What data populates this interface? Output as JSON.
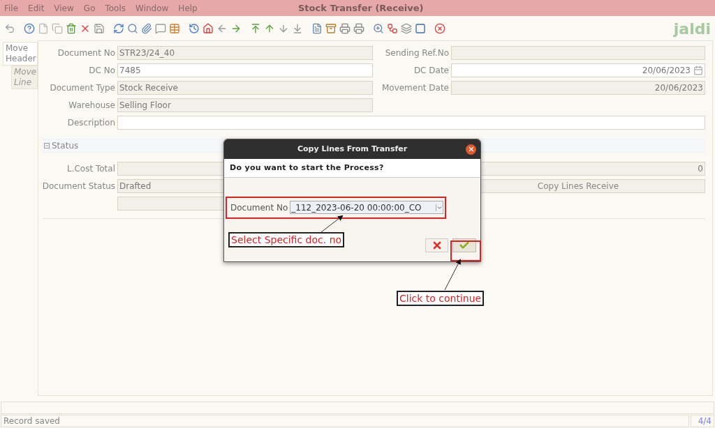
{
  "window": {
    "title": "Stock Transfer (Receive)"
  },
  "menu": [
    {
      "label": "File"
    },
    {
      "label": "Edit"
    },
    {
      "label": "View"
    },
    {
      "label": "Go"
    },
    {
      "label": "Tools"
    },
    {
      "label": "Window"
    },
    {
      "label": "Help"
    }
  ],
  "logo": "jaldi",
  "side_tabs": [
    {
      "label": "Move Header",
      "selected": true
    },
    {
      "label": "Move Line",
      "selected": false
    }
  ],
  "header_rows": [
    {
      "left": {
        "label": "Document No",
        "value": "STR23/24_40",
        "editable": false
      },
      "right": {
        "label": "Sending Ref.No",
        "editable": false
      }
    },
    {
      "left": {
        "label": "DC No",
        "value": "7485",
        "editable": true
      },
      "right": {
        "label": "DC Date",
        "value": "20/06/2023",
        "editable": true,
        "kind": "date"
      }
    },
    {
      "left": {
        "label": "Document Type",
        "value": "Stock Receive",
        "editable": false
      },
      "right": {
        "label": "Movement Date",
        "value": "20/06/2023",
        "editable": false
      }
    },
    {
      "left": {
        "label": "Warehouse",
        "value": "Selling Floor",
        "editable": false
      }
    }
  ],
  "description": {
    "label": "Description",
    "editable": true
  },
  "status_section": {
    "title": "Status",
    "expanded": true,
    "cost_total": {
      "label": "L.Cost Total",
      "value": "0"
    },
    "document_status": {
      "label": "Document Status",
      "value": "Drafted"
    },
    "copy_button": "Copy Lines Receive"
  },
  "dialog": {
    "title": "Copy Lines From Transfer",
    "question": "Do you want to start the Process?",
    "param_label": "Document No",
    "param_value": "_112_2023-06-20 00:00:00_CO"
  },
  "annotations": [
    {
      "kind": "select",
      "text": "Select Specific doc. no"
    },
    {
      "kind": "continue",
      "text": "Click to continue"
    }
  ],
  "status_bar": {
    "message": "Record saved",
    "record": "4/4"
  }
}
